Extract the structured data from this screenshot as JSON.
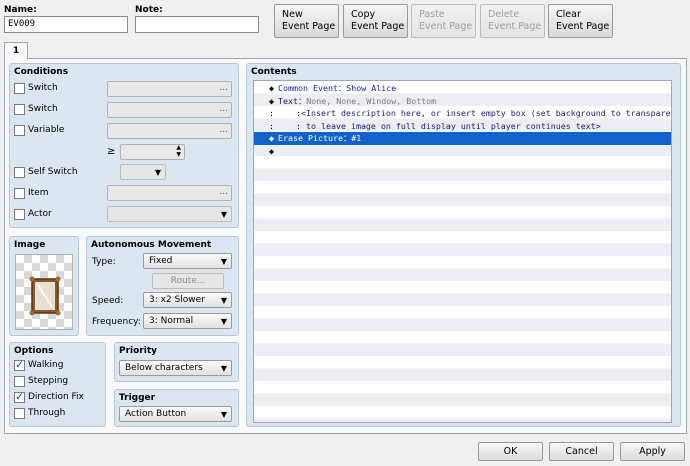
{
  "header": {
    "name_label": "Name:",
    "name_value": "EV009",
    "note_label": "Note:",
    "note_value": ""
  },
  "toolbar": {
    "new_line1": "New",
    "new_line2": "Event Page",
    "copy_line1": "Copy",
    "copy_line2": "Event Page",
    "paste_line1": "Paste",
    "paste_line2": "Event Page",
    "delete_line1": "Delete",
    "delete_line2": "Event Page",
    "clear_line1": "Clear",
    "clear_line2": "Event Page"
  },
  "tabs": [
    {
      "label": "1"
    }
  ],
  "conditions": {
    "title": "Conditions",
    "switch1_label": "Switch",
    "switch2_label": "Switch",
    "variable_label": "Variable",
    "gte_symbol": "≥",
    "self_switch_label": "Self Switch",
    "item_label": "Item",
    "actor_label": "Actor",
    "ellipsis": "..."
  },
  "image": {
    "title": "Image"
  },
  "movement": {
    "title": "Autonomous Movement",
    "type_label": "Type:",
    "type_value": "Fixed",
    "route_button": "Route...",
    "speed_label": "Speed:",
    "speed_value": "3: x2 Slower",
    "frequency_label": "Frequency:",
    "frequency_value": "3: Normal"
  },
  "options": {
    "title": "Options",
    "walking": "Walking",
    "walking_checked": true,
    "stepping": "Stepping",
    "stepping_checked": false,
    "direction_fix": "Direction Fix",
    "direction_fix_checked": true,
    "through": "Through",
    "through_checked": false
  },
  "priority": {
    "title": "Priority",
    "value": "Below characters"
  },
  "trigger": {
    "title": "Trigger",
    "value": "Action Button"
  },
  "contents": {
    "title": "Contents",
    "rows": [
      {
        "marker": "◆",
        "cmd": "Common Event",
        "sep": "：",
        "arg": "Show Alice"
      },
      {
        "marker": "◆",
        "cmd": "Text",
        "sep": "：",
        "arg": "None, None, Window, Bottom"
      },
      {
        "marker": ":",
        "cmd": "",
        "sep": ":",
        "arg": "<Insert description here, or insert empty box (set background to transparent)"
      },
      {
        "marker": ":",
        "cmd": "",
        "sep": ":",
        "arg": " to leave image on full display until player continues text>"
      },
      {
        "marker": "◆",
        "cmd": "Erase Picture",
        "sep": "：",
        "arg": "#1"
      },
      {
        "marker": "◆",
        "cmd": "",
        "sep": "",
        "arg": ""
      }
    ]
  },
  "footer": {
    "ok": "OK",
    "cancel": "Cancel",
    "apply": "Apply"
  }
}
